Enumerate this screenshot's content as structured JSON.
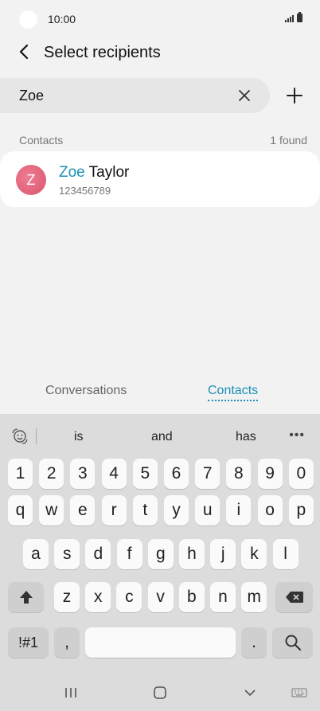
{
  "status": {
    "time": "10:00"
  },
  "header": {
    "title": "Select recipients"
  },
  "search": {
    "value": "Zoe"
  },
  "section": {
    "label": "Contacts",
    "count": "1 found"
  },
  "contact": {
    "initial": "Z",
    "name_match": "Zoe",
    "name_rest": " Taylor",
    "number": "123456789"
  },
  "tabs": {
    "conversations": "Conversations",
    "contacts": "Contacts"
  },
  "suggestions": [
    "is",
    "and",
    "has"
  ],
  "keyboard": {
    "numbers": [
      "1",
      "2",
      "3",
      "4",
      "5",
      "6",
      "7",
      "8",
      "9",
      "0"
    ],
    "row1": [
      "q",
      "w",
      "e",
      "r",
      "t",
      "y",
      "u",
      "i",
      "o",
      "p"
    ],
    "row2": [
      "a",
      "s",
      "d",
      "f",
      "g",
      "h",
      "j",
      "k",
      "l"
    ],
    "row3": [
      "z",
      "x",
      "c",
      "v",
      "b",
      "n",
      "m"
    ],
    "symbols": "!#1",
    "comma": ",",
    "period": "."
  },
  "colors": {
    "accent": "#1b8fb5",
    "avatar": "#e06a80",
    "keyboard_bg": "#dcdcdc"
  }
}
